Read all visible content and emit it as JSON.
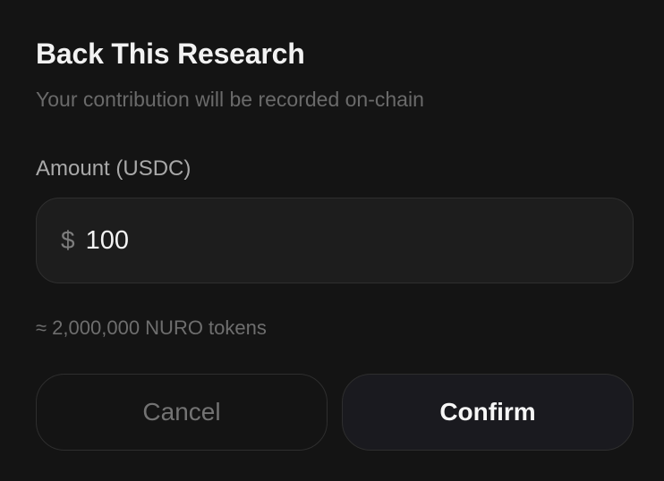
{
  "dialog": {
    "title": "Back This Research",
    "subtitle": "Your contribution will be recorded on-chain"
  },
  "amount": {
    "label": "Amount (USDC)",
    "currency_symbol": "$",
    "value": "100"
  },
  "estimate": "≈ 2,000,000 NURO tokens",
  "actions": {
    "cancel_label": "Cancel",
    "confirm_label": "Confirm"
  }
}
